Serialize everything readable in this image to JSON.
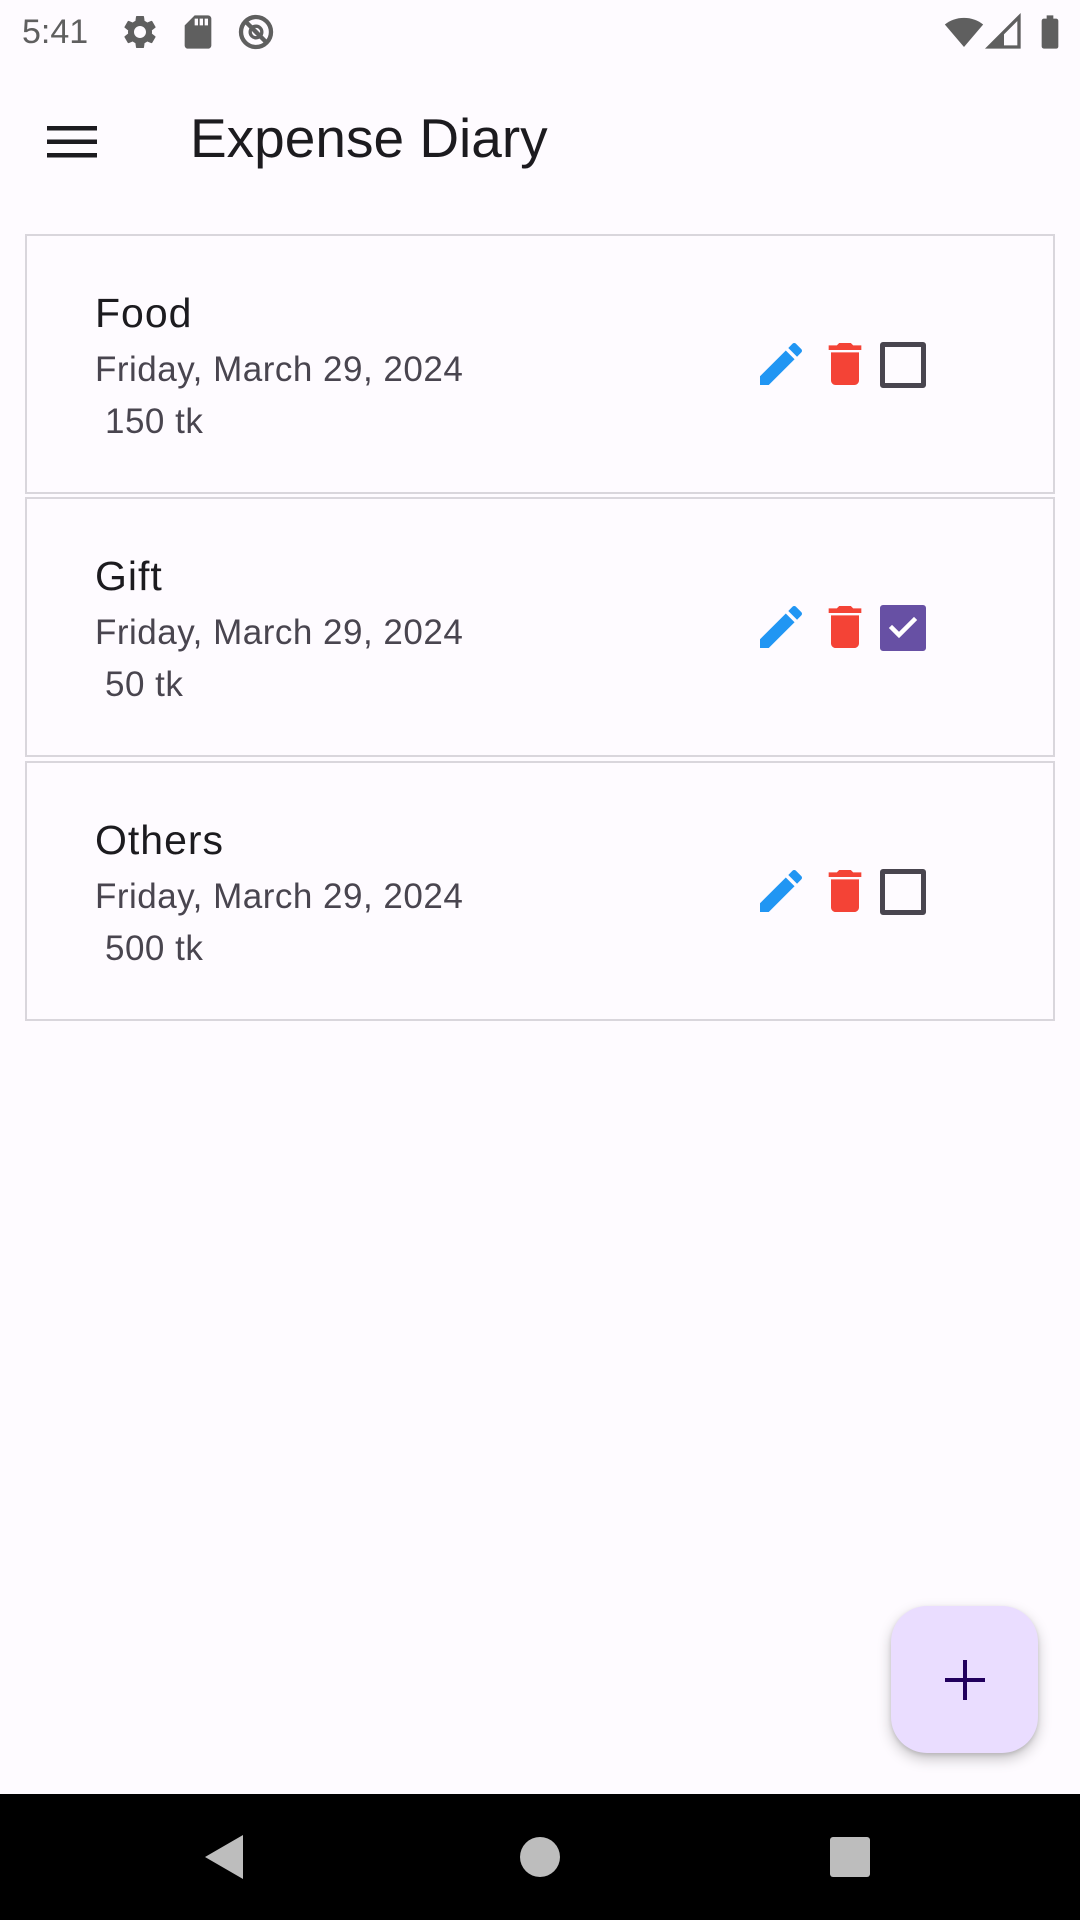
{
  "status_bar": {
    "time": "5:41",
    "icons": [
      "settings-icon",
      "sd-card-icon",
      "do-not-disturb-icon",
      "wifi-icon",
      "signal-icon",
      "battery-icon"
    ]
  },
  "app_bar": {
    "title": "Expense Diary",
    "menu_icon": "menu-icon"
  },
  "expenses": [
    {
      "title": "Food",
      "date": "Friday, March 29, 2024",
      "amount": " 150 tk",
      "checked": false
    },
    {
      "title": "Gift",
      "date": "Friday, March 29, 2024",
      "amount": " 50 tk",
      "checked": true
    },
    {
      "title": "Others",
      "date": "Friday, March 29, 2024",
      "amount": " 500 tk",
      "checked": false
    }
  ],
  "colors": {
    "edit": "#2196f3",
    "delete": "#f44336",
    "checkbox_checked": "#6750a4",
    "fab_background": "#eaddff",
    "fab_icon": "#21005d"
  },
  "fab": {
    "icon": "add-icon"
  },
  "nav_bar": {
    "icons": [
      "back-icon",
      "home-icon",
      "recents-icon"
    ]
  }
}
